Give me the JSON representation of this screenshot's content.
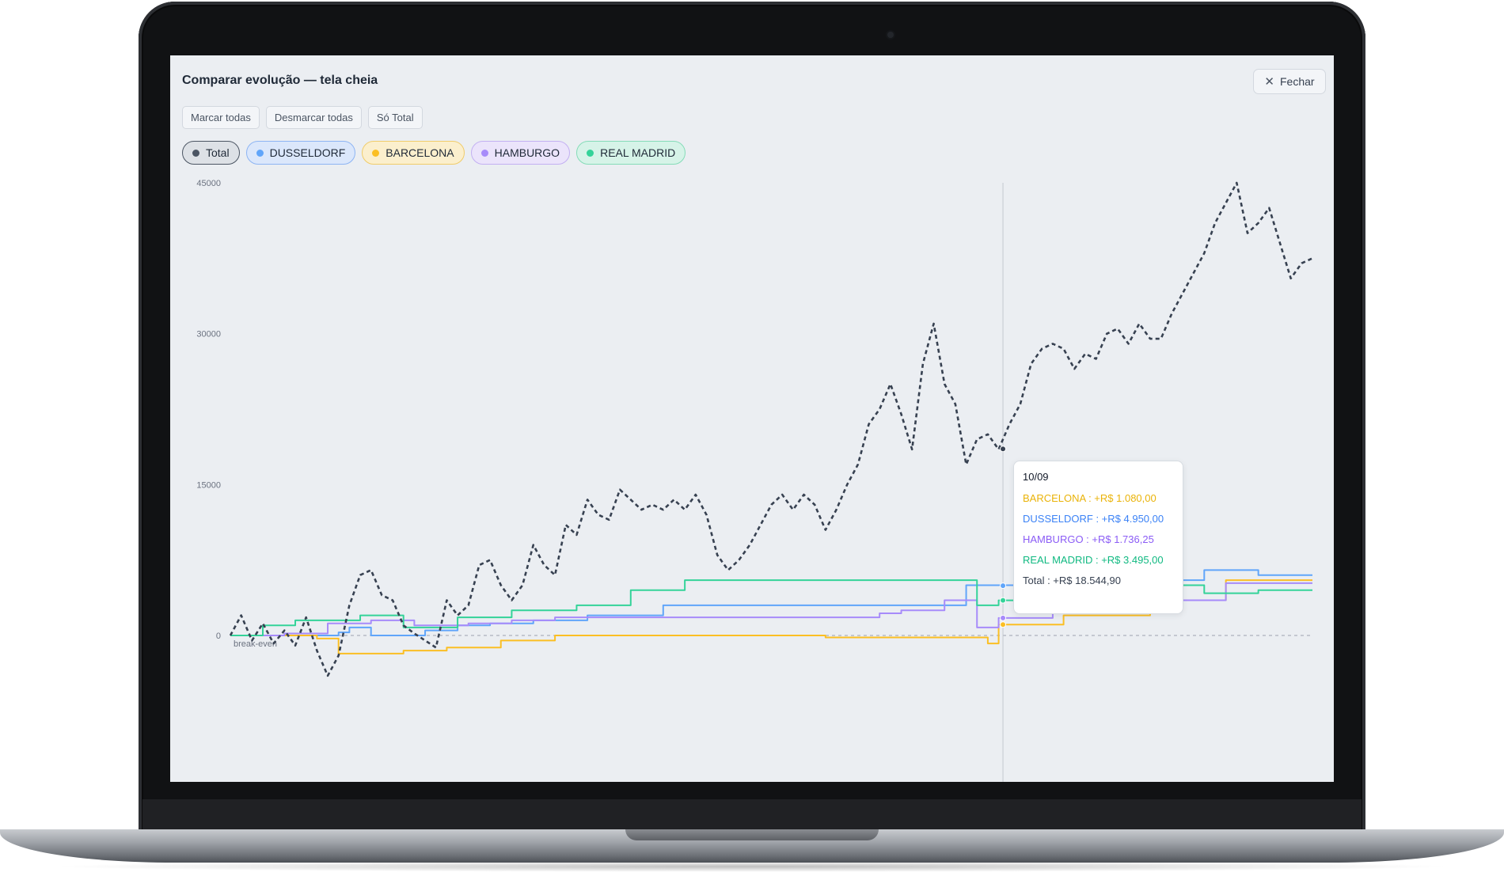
{
  "window": {
    "title": "Comparar evolução — tela cheia",
    "close_label": "Fechar"
  },
  "toolbar": {
    "mark_all": "Marcar todas",
    "unmark_all": "Desmarcar todas",
    "only_total": "Só Total"
  },
  "chips": [
    {
      "label": "Total",
      "color": "#4b5563"
    },
    {
      "label": "DUSSELDORF",
      "color": "#60a5fa"
    },
    {
      "label": "BARCELONA",
      "color": "#fbbf24"
    },
    {
      "label": "HAMBURGO",
      "color": "#a78bfa"
    },
    {
      "label": "REAL MADRID",
      "color": "#34d399"
    }
  ],
  "tooltip": {
    "date": "10/09",
    "rows": [
      {
        "text": "BARCELONA : +R$ 1.080,00",
        "color": "#eab308"
      },
      {
        "text": "DUSSELDORF : +R$ 4.950,00",
        "color": "#3b82f6"
      },
      {
        "text": "HAMBURGO : +R$ 1.736,25",
        "color": "#8b5cf6"
      },
      {
        "text": "REAL MADRID : +R$ 3.495,00",
        "color": "#10b981"
      },
      {
        "text": "Total : +R$ 18.544,90",
        "color": "#374151"
      }
    ]
  },
  "chart_data": {
    "type": "line",
    "y_ticks": [
      "45000",
      "30000",
      "15000",
      "0"
    ],
    "ylim": [
      -5000,
      45000
    ],
    "x_range": [
      0,
      100
    ],
    "reference_line": {
      "value": 0,
      "label": "break-even"
    },
    "cursor_x": 71.4,
    "series": [
      {
        "name": "Total",
        "color": "#374151",
        "dashed": true,
        "points": [
          [
            0,
            0
          ],
          [
            1,
            2000
          ],
          [
            2,
            -500
          ],
          [
            3,
            1200
          ],
          [
            4,
            -800
          ],
          [
            5,
            500
          ],
          [
            6,
            -1000
          ],
          [
            7,
            1800
          ],
          [
            8,
            -1500
          ],
          [
            9,
            -4000
          ],
          [
            10,
            -2000
          ],
          [
            11,
            3000
          ],
          [
            12,
            6000
          ],
          [
            13,
            6500
          ],
          [
            14,
            4000
          ],
          [
            15,
            3500
          ],
          [
            16,
            1000
          ],
          [
            17,
            200
          ],
          [
            18,
            -500
          ],
          [
            19,
            -1200
          ],
          [
            20,
            3500
          ],
          [
            21,
            2000
          ],
          [
            22,
            3000
          ],
          [
            23,
            7000
          ],
          [
            24,
            7500
          ],
          [
            25,
            5000
          ],
          [
            26,
            3500
          ],
          [
            27,
            5000
          ],
          [
            28,
            9000
          ],
          [
            29,
            7000
          ],
          [
            30,
            6000
          ],
          [
            31,
            11000
          ],
          [
            32,
            10000
          ],
          [
            33,
            13500
          ],
          [
            34,
            12000
          ],
          [
            35,
            11500
          ],
          [
            36,
            14500
          ],
          [
            37,
            13500
          ],
          [
            38,
            12500
          ],
          [
            39,
            13000
          ],
          [
            40,
            12500
          ],
          [
            41,
            13500
          ],
          [
            42,
            12500
          ],
          [
            43,
            14000
          ],
          [
            44,
            12000
          ],
          [
            45,
            8000
          ],
          [
            46,
            6500
          ],
          [
            47,
            7500
          ],
          [
            48,
            9000
          ],
          [
            49,
            11000
          ],
          [
            50,
            13000
          ],
          [
            51,
            14000
          ],
          [
            52,
            12500
          ],
          [
            53,
            14000
          ],
          [
            54,
            13000
          ],
          [
            55,
            10500
          ],
          [
            56,
            12500
          ],
          [
            57,
            15000
          ],
          [
            58,
            17000
          ],
          [
            59,
            21000
          ],
          [
            60,
            22500
          ],
          [
            61,
            25000
          ],
          [
            62,
            22000
          ],
          [
            63,
            18500
          ],
          [
            64,
            27000
          ],
          [
            65,
            31000
          ],
          [
            66,
            25000
          ],
          [
            67,
            23000
          ],
          [
            68,
            17000
          ],
          [
            69,
            19500
          ],
          [
            70,
            20000
          ],
          [
            71,
            18500
          ],
          [
            72,
            21000
          ],
          [
            73,
            23000
          ],
          [
            74,
            27000
          ],
          [
            75,
            28500
          ],
          [
            76,
            29000
          ],
          [
            77,
            28500
          ],
          [
            78,
            26500
          ],
          [
            79,
            28000
          ],
          [
            80,
            27500
          ],
          [
            81,
            30000
          ],
          [
            82,
            30500
          ],
          [
            83,
            29000
          ],
          [
            84,
            31000
          ],
          [
            85,
            29500
          ],
          [
            86,
            29500
          ],
          [
            87,
            32000
          ],
          [
            88,
            34000
          ],
          [
            89,
            36000
          ],
          [
            90,
            38000
          ],
          [
            91,
            41000
          ],
          [
            92,
            43000
          ],
          [
            93,
            45000
          ],
          [
            94,
            40000
          ],
          [
            95,
            41000
          ],
          [
            96,
            42500
          ],
          [
            97,
            39000
          ],
          [
            98,
            35500
          ],
          [
            99,
            37000
          ],
          [
            100,
            37500
          ]
        ]
      },
      {
        "name": "DUSSELDORF",
        "color": "#60a5fa",
        "dashed": false,
        "points": [
          [
            0,
            0
          ],
          [
            3,
            0
          ],
          [
            10,
            300
          ],
          [
            11,
            800
          ],
          [
            13,
            0
          ],
          [
            16,
            0
          ],
          [
            18,
            500
          ],
          [
            21,
            1000
          ],
          [
            24,
            1200
          ],
          [
            28,
            1500
          ],
          [
            33,
            2000
          ],
          [
            40,
            3000
          ],
          [
            64,
            3000
          ],
          [
            68,
            5000
          ],
          [
            75,
            5000
          ],
          [
            80,
            5200
          ],
          [
            85,
            5500
          ],
          [
            90,
            6500
          ],
          [
            95,
            6000
          ],
          [
            100,
            6000
          ]
        ]
      },
      {
        "name": "BARCELONA",
        "color": "#fbbf24",
        "dashed": false,
        "points": [
          [
            0,
            0
          ],
          [
            8,
            -300
          ],
          [
            10,
            -1800
          ],
          [
            16,
            -1500
          ],
          [
            20,
            -1200
          ],
          [
            25,
            -500
          ],
          [
            30,
            0
          ],
          [
            40,
            0
          ],
          [
            55,
            -200
          ],
          [
            70,
            -800
          ],
          [
            71,
            1080
          ],
          [
            77,
            2000
          ],
          [
            85,
            3500
          ],
          [
            92,
            5500
          ],
          [
            100,
            5500
          ]
        ]
      },
      {
        "name": "HAMBURGO",
        "color": "#a78bfa",
        "dashed": false,
        "points": [
          [
            0,
            0
          ],
          [
            5,
            200
          ],
          [
            9,
            1200
          ],
          [
            13,
            1500
          ],
          [
            17,
            1000
          ],
          [
            22,
            1200
          ],
          [
            26,
            1500
          ],
          [
            30,
            1800
          ],
          [
            34,
            1800
          ],
          [
            45,
            1800
          ],
          [
            60,
            2200
          ],
          [
            62,
            2500
          ],
          [
            66,
            3500
          ],
          [
            68,
            3500
          ],
          [
            69,
            800
          ],
          [
            71,
            1736
          ],
          [
            76,
            2300
          ],
          [
            85,
            3500
          ],
          [
            92,
            5200
          ],
          [
            100,
            5200
          ]
        ]
      },
      {
        "name": "REAL MADRID",
        "color": "#34d399",
        "dashed": false,
        "points": [
          [
            0,
            0
          ],
          [
            3,
            1000
          ],
          [
            6,
            1500
          ],
          [
            12,
            2000
          ],
          [
            16,
            800
          ],
          [
            21,
            1800
          ],
          [
            26,
            2500
          ],
          [
            32,
            3000
          ],
          [
            37,
            4500
          ],
          [
            42,
            5500
          ],
          [
            47,
            5500
          ],
          [
            64,
            5500
          ],
          [
            69,
            3000
          ],
          [
            71,
            3495
          ],
          [
            80,
            4000
          ],
          [
            86,
            5000
          ],
          [
            90,
            4200
          ],
          [
            95,
            4500
          ],
          [
            100,
            4500
          ]
        ]
      }
    ]
  }
}
